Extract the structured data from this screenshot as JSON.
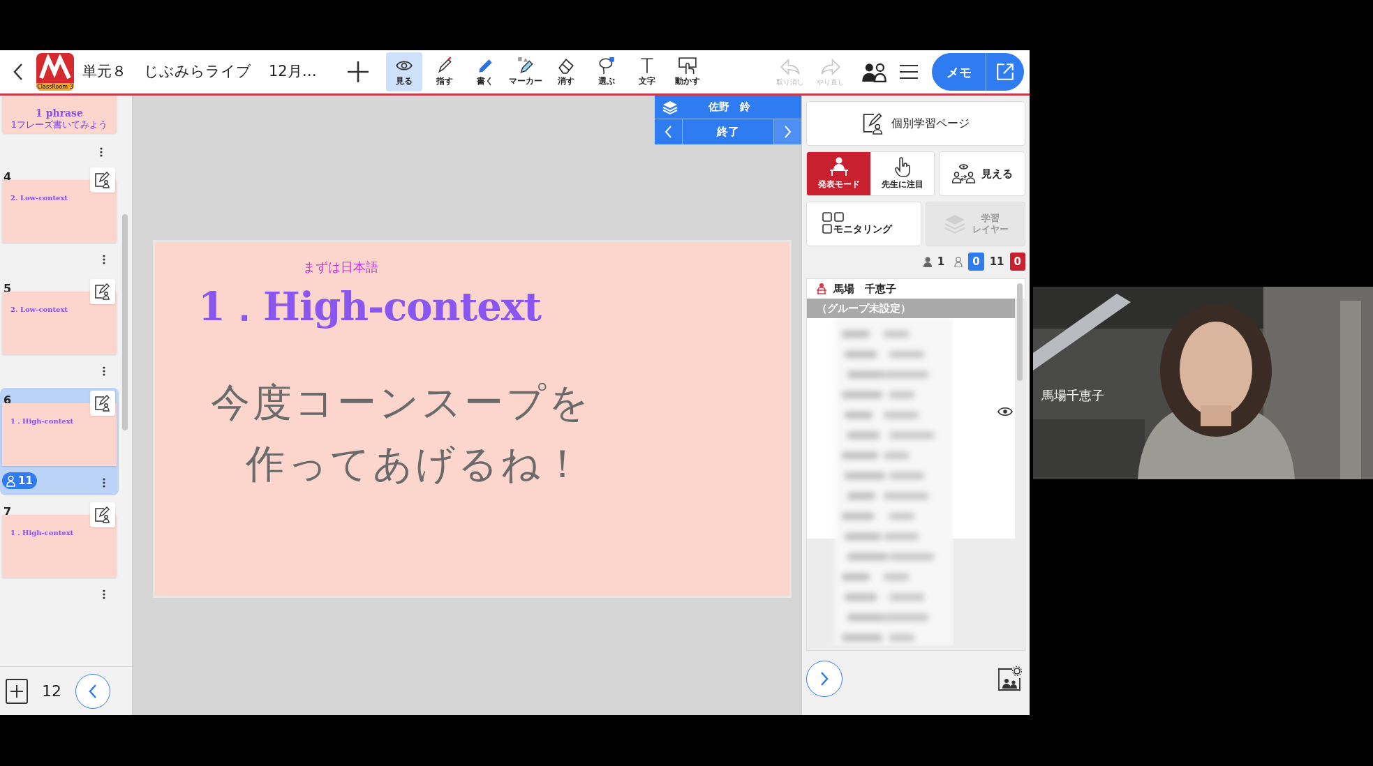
{
  "header": {
    "title_parts": [
      "単元８",
      "じぶみらライブ",
      "12月…"
    ],
    "logo": {
      "caption": "ClassRoom 3"
    },
    "tools": [
      {
        "kind": "eye",
        "label": "見る",
        "selected": true
      },
      {
        "kind": "pointer",
        "label": "指す",
        "selected": false
      },
      {
        "kind": "pen",
        "label": "書く",
        "selected": false
      },
      {
        "kind": "marker",
        "label": "マーカー",
        "selected": false
      },
      {
        "kind": "eraser",
        "label": "消す",
        "selected": false
      },
      {
        "kind": "lasso",
        "label": "選ぶ",
        "selected": false
      },
      {
        "kind": "text",
        "label": "文字",
        "selected": false
      },
      {
        "kind": "move",
        "label": "動かす",
        "selected": false
      }
    ],
    "history": [
      {
        "kind": "undo",
        "label": "取り消し",
        "disabled": true
      },
      {
        "kind": "redo",
        "label": "やり直し",
        "disabled": true
      }
    ],
    "memo_button": "メモ"
  },
  "slides_panel": {
    "partial_slide": {
      "title": "1 phrase",
      "subtitle": "1フレーズ書いてみよう"
    },
    "slides": [
      {
        "number": "4",
        "title": "2. Low-context",
        "selected": false
      },
      {
        "number": "5",
        "title": "2. Low-context",
        "selected": false
      },
      {
        "number": "6",
        "title": "1．High-context",
        "selected": true,
        "viewers": "11"
      },
      {
        "number": "7",
        "title": "1．High-context",
        "selected": false
      }
    ],
    "page_count": "12"
  },
  "presenter": {
    "name": "佐野　鈴",
    "end_button": "終了"
  },
  "slide": {
    "note": "まずは日本語",
    "title": "1．High-context",
    "handwriting": [
      "今度コーンスープを",
      "作ってあげるね！"
    ]
  },
  "right_panel": {
    "individual_page": "個別学習ページ",
    "modes": [
      {
        "kind": "presenter",
        "label": "発表モード",
        "selected": true
      },
      {
        "kind": "hand",
        "label": "先生に注目",
        "selected": false
      },
      {
        "kind": "share",
        "label": "見える",
        "selected": false
      }
    ],
    "monitoring": "モニタリング",
    "layer": {
      "label_lines": [
        "学習",
        "レイヤー"
      ],
      "disabled": true
    },
    "counts": {
      "teachers": "1",
      "blue": "0",
      "students": "11",
      "red": "0"
    },
    "teacher": "馬場　千恵子",
    "group": "（グループ未設定）"
  },
  "video": {
    "name": "馬場千恵子"
  }
}
